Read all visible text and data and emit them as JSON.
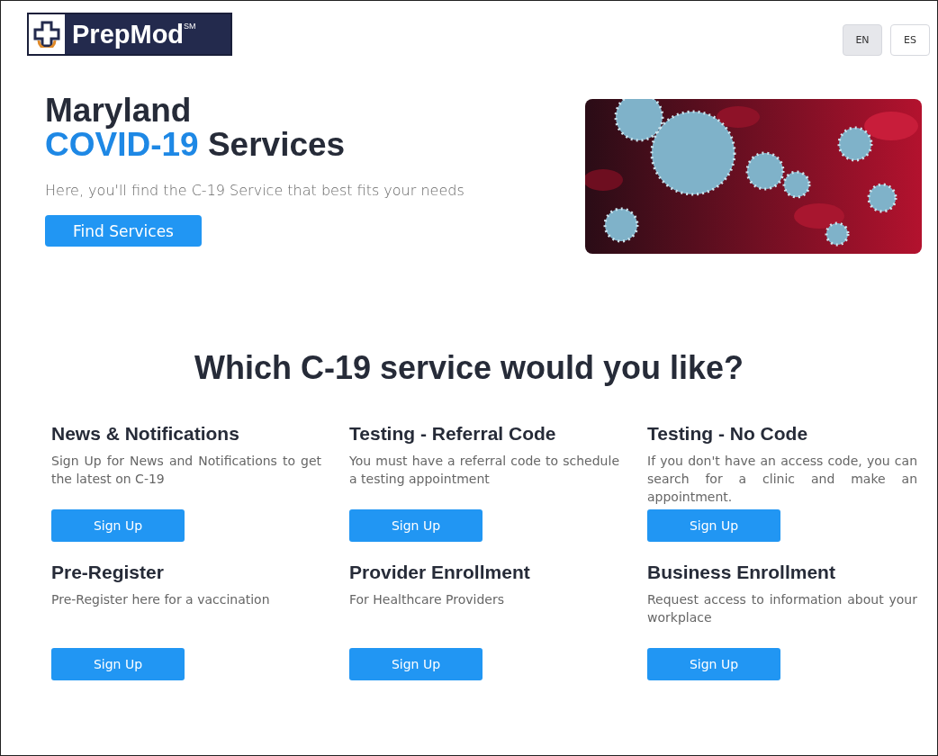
{
  "logo": {
    "text": "PrepMod$^{SM}$"
  },
  "languages": [
    {
      "label": "EN",
      "selected": true
    },
    {
      "label": "ES",
      "selected": false
    }
  ],
  "hero": {
    "title_line1": "Maryland",
    "title_highlight": "COVID-19",
    "title_rest": "Services",
    "subtitle": "Here, you'll find the C-19 Service that best fits your needs",
    "button": "Find Services"
  },
  "services_heading": "Which C-19 service would you like?",
  "services": [
    {
      "title": "News & Notifications",
      "description": "Sign Up for News and Notifications to get the latest on C-19",
      "button": "Sign Up"
    },
    {
      "title": "Testing - Referral Code",
      "description": "You must have a referral code to schedule a testing appointment",
      "button": "Sign Up"
    },
    {
      "title": "Testing - No Code",
      "description": "If you don't have an access code, you can search for a clinic and make an appointment.",
      "button": "Sign Up"
    },
    {
      "title": "Pre-Register",
      "description": "Pre-Register here for a vaccination",
      "button": "Sign Up"
    },
    {
      "title": "Provider Enrollment",
      "description": "For Healthcare Providers",
      "button": "Sign Up"
    },
    {
      "title": "Business Enrollment",
      "description": "Request access to information about your workplace",
      "button": "Sign Up"
    }
  ]
}
